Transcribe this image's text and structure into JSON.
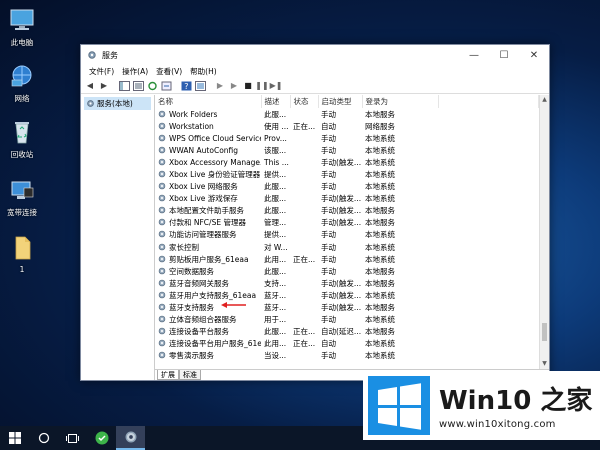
{
  "desktop": {
    "icons": [
      {
        "label": "此电脑"
      },
      {
        "label": "网络"
      },
      {
        "label": "回收站"
      },
      {
        "label": "宽带连接"
      },
      {
        "label": "1"
      }
    ]
  },
  "window": {
    "title": "服务",
    "controls": {
      "minimize": "—",
      "maximize": "☐",
      "close": "✕"
    }
  },
  "menu": [
    "文件(F)",
    "操作(A)",
    "查看(V)",
    "帮助(H)"
  ],
  "tree": {
    "root_label": "服务(本地)"
  },
  "table": {
    "columns": [
      "名称",
      "描述",
      "状态",
      "启动类型",
      "登录为"
    ],
    "rows": [
      {
        "name": "Work Folders",
        "desc": "此服...",
        "status": "",
        "startup": "手动",
        "logon": "本地服务"
      },
      {
        "name": "Workstation",
        "desc": "使用 ...",
        "status": "正在...",
        "startup": "自动",
        "logon": "网络服务"
      },
      {
        "name": "WPS Office Cloud Service",
        "desc": "Prov...",
        "status": "",
        "startup": "手动",
        "logon": "本地系统"
      },
      {
        "name": "WWAN AutoConfig",
        "desc": "该服...",
        "status": "",
        "startup": "手动",
        "logon": "本地系统"
      },
      {
        "name": "Xbox Accessory Manage...",
        "desc": "This ...",
        "status": "",
        "startup": "手动(触发...",
        "logon": "本地系统"
      },
      {
        "name": "Xbox Live 身份验证管理器",
        "desc": "提供...",
        "status": "",
        "startup": "手动",
        "logon": "本地系统"
      },
      {
        "name": "Xbox Live 网络服务",
        "desc": "此服...",
        "status": "",
        "startup": "手动",
        "logon": "本地系统"
      },
      {
        "name": "Xbox Live 游戏保存",
        "desc": "此服...",
        "status": "",
        "startup": "手动(触发...",
        "logon": "本地系统"
      },
      {
        "name": "本地配置文件助手服务",
        "desc": "此服...",
        "status": "",
        "startup": "手动(触发...",
        "logon": "本地服务"
      },
      {
        "name": "付款和 NFC/SE 管理器",
        "desc": "管理...",
        "status": "",
        "startup": "手动(触发...",
        "logon": "本地服务"
      },
      {
        "name": "功能访问管理器服务",
        "desc": "提供...",
        "status": "",
        "startup": "手动",
        "logon": "本地系统"
      },
      {
        "name": "家长控制",
        "desc": "对 W...",
        "status": "",
        "startup": "手动",
        "logon": "本地系统"
      },
      {
        "name": "剪贴板用户服务_61eaa",
        "desc": "此用...",
        "status": "正在...",
        "startup": "手动",
        "logon": "本地系统"
      },
      {
        "name": "空间数据服务",
        "desc": "此服...",
        "status": "",
        "startup": "手动",
        "logon": "本地服务"
      },
      {
        "name": "蓝牙音频网关服务",
        "desc": "支持...",
        "status": "",
        "startup": "手动(触发...",
        "logon": "本地服务"
      },
      {
        "name": "蓝牙用户支持服务_61eaa",
        "desc": "蓝牙...",
        "status": "",
        "startup": "手动(触发...",
        "logon": "本地系统"
      },
      {
        "name": "蓝牙支持服务",
        "desc": "蓝牙...",
        "status": "",
        "startup": "手动(触发...",
        "logon": "本地服务"
      },
      {
        "name": "立体音频组合器服务",
        "desc": "用于...",
        "status": "",
        "startup": "手动",
        "logon": "本地系统"
      },
      {
        "name": "连接设备平台服务",
        "desc": "此服...",
        "status": "正在...",
        "startup": "自动(延迟...",
        "logon": "本地服务"
      },
      {
        "name": "连接设备平台用户服务_61e...",
        "desc": "此用...",
        "status": "正在...",
        "startup": "自动",
        "logon": "本地系统"
      },
      {
        "name": "零售演示服务",
        "desc": "当设...",
        "status": "",
        "startup": "手动",
        "logon": "本地系统"
      }
    ]
  },
  "tabs": [
    "扩展",
    "标准"
  ],
  "watermark": {
    "brand": "Win10 之家",
    "url": "www.win10xitong.com"
  },
  "colors": {
    "selection": "#cce4f7",
    "arrow": "#e02020",
    "accent": "#0078d7"
  }
}
